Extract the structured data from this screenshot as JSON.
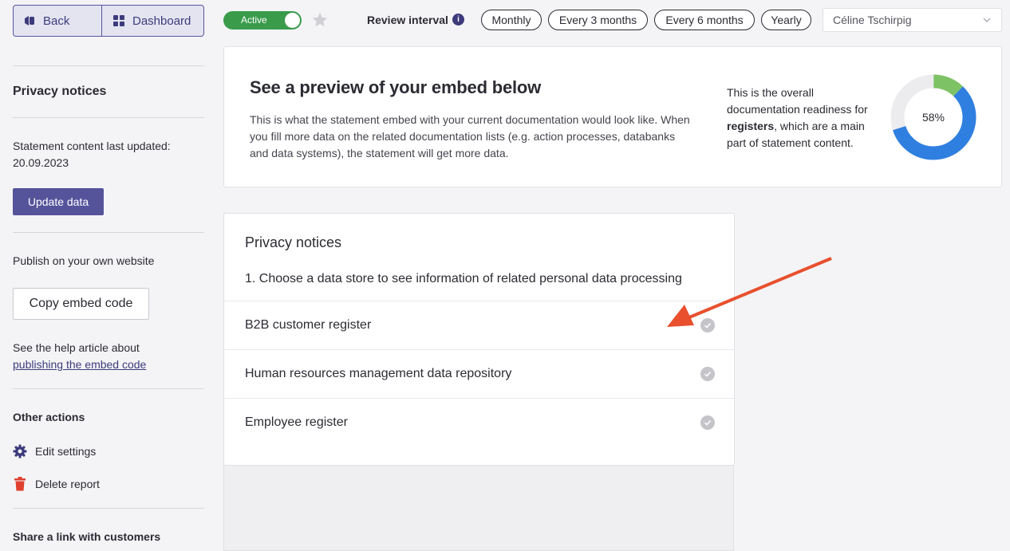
{
  "nav": {
    "back_label": "Back",
    "dashboard_label": "Dashboard"
  },
  "sidebar": {
    "title": "Privacy notices",
    "updated_label": "Statement content last updated:",
    "updated_date": "20.09.2023",
    "update_button": "Update data",
    "publish_label": "Publish on your own website",
    "copy_button": "Copy embed code",
    "help_text": "See the help article about",
    "help_link": "publishing the embed code",
    "other_actions_title": "Other actions",
    "actions": [
      {
        "label": "Edit settings",
        "icon": "gear-icon"
      },
      {
        "label": "Delete report",
        "icon": "trash-icon"
      }
    ],
    "share_title": "Share a link with customers"
  },
  "topbar": {
    "status_label": "Active",
    "status_on": true,
    "review_interval_label": "Review interval",
    "intervals": [
      "Monthly",
      "Every 3 months",
      "Every 6 months",
      "Yearly"
    ],
    "user_name": "Céline Tschirpig"
  },
  "preview": {
    "title": "See a preview of your embed below",
    "description": "This is what the statement embed with your current documentation would look like. When you fill more data on the related documentation lists (e.g. action processes, databanks and data systems), the statement will get more data.",
    "readiness_pre": "This is the overall documentation readiness for",
    "readiness_bold": "registers",
    "readiness_post": ", which are a main part of statement content.",
    "readiness_percent": 58,
    "readiness_label": "58%",
    "colors": {
      "progress": "#2f7fe0",
      "extra": "#7dc265",
      "track": "#ececef"
    }
  },
  "embed": {
    "title": "Privacy notices",
    "step": "1. Choose a data store to see information of related personal data processing",
    "items": [
      {
        "label": "B2B customer register"
      },
      {
        "label": "Human resources management data repository"
      },
      {
        "label": "Employee register"
      }
    ]
  },
  "colors": {
    "brand": "#55539a",
    "active_green": "#3a9b4b",
    "annotation_arrow": "#e8502e"
  }
}
